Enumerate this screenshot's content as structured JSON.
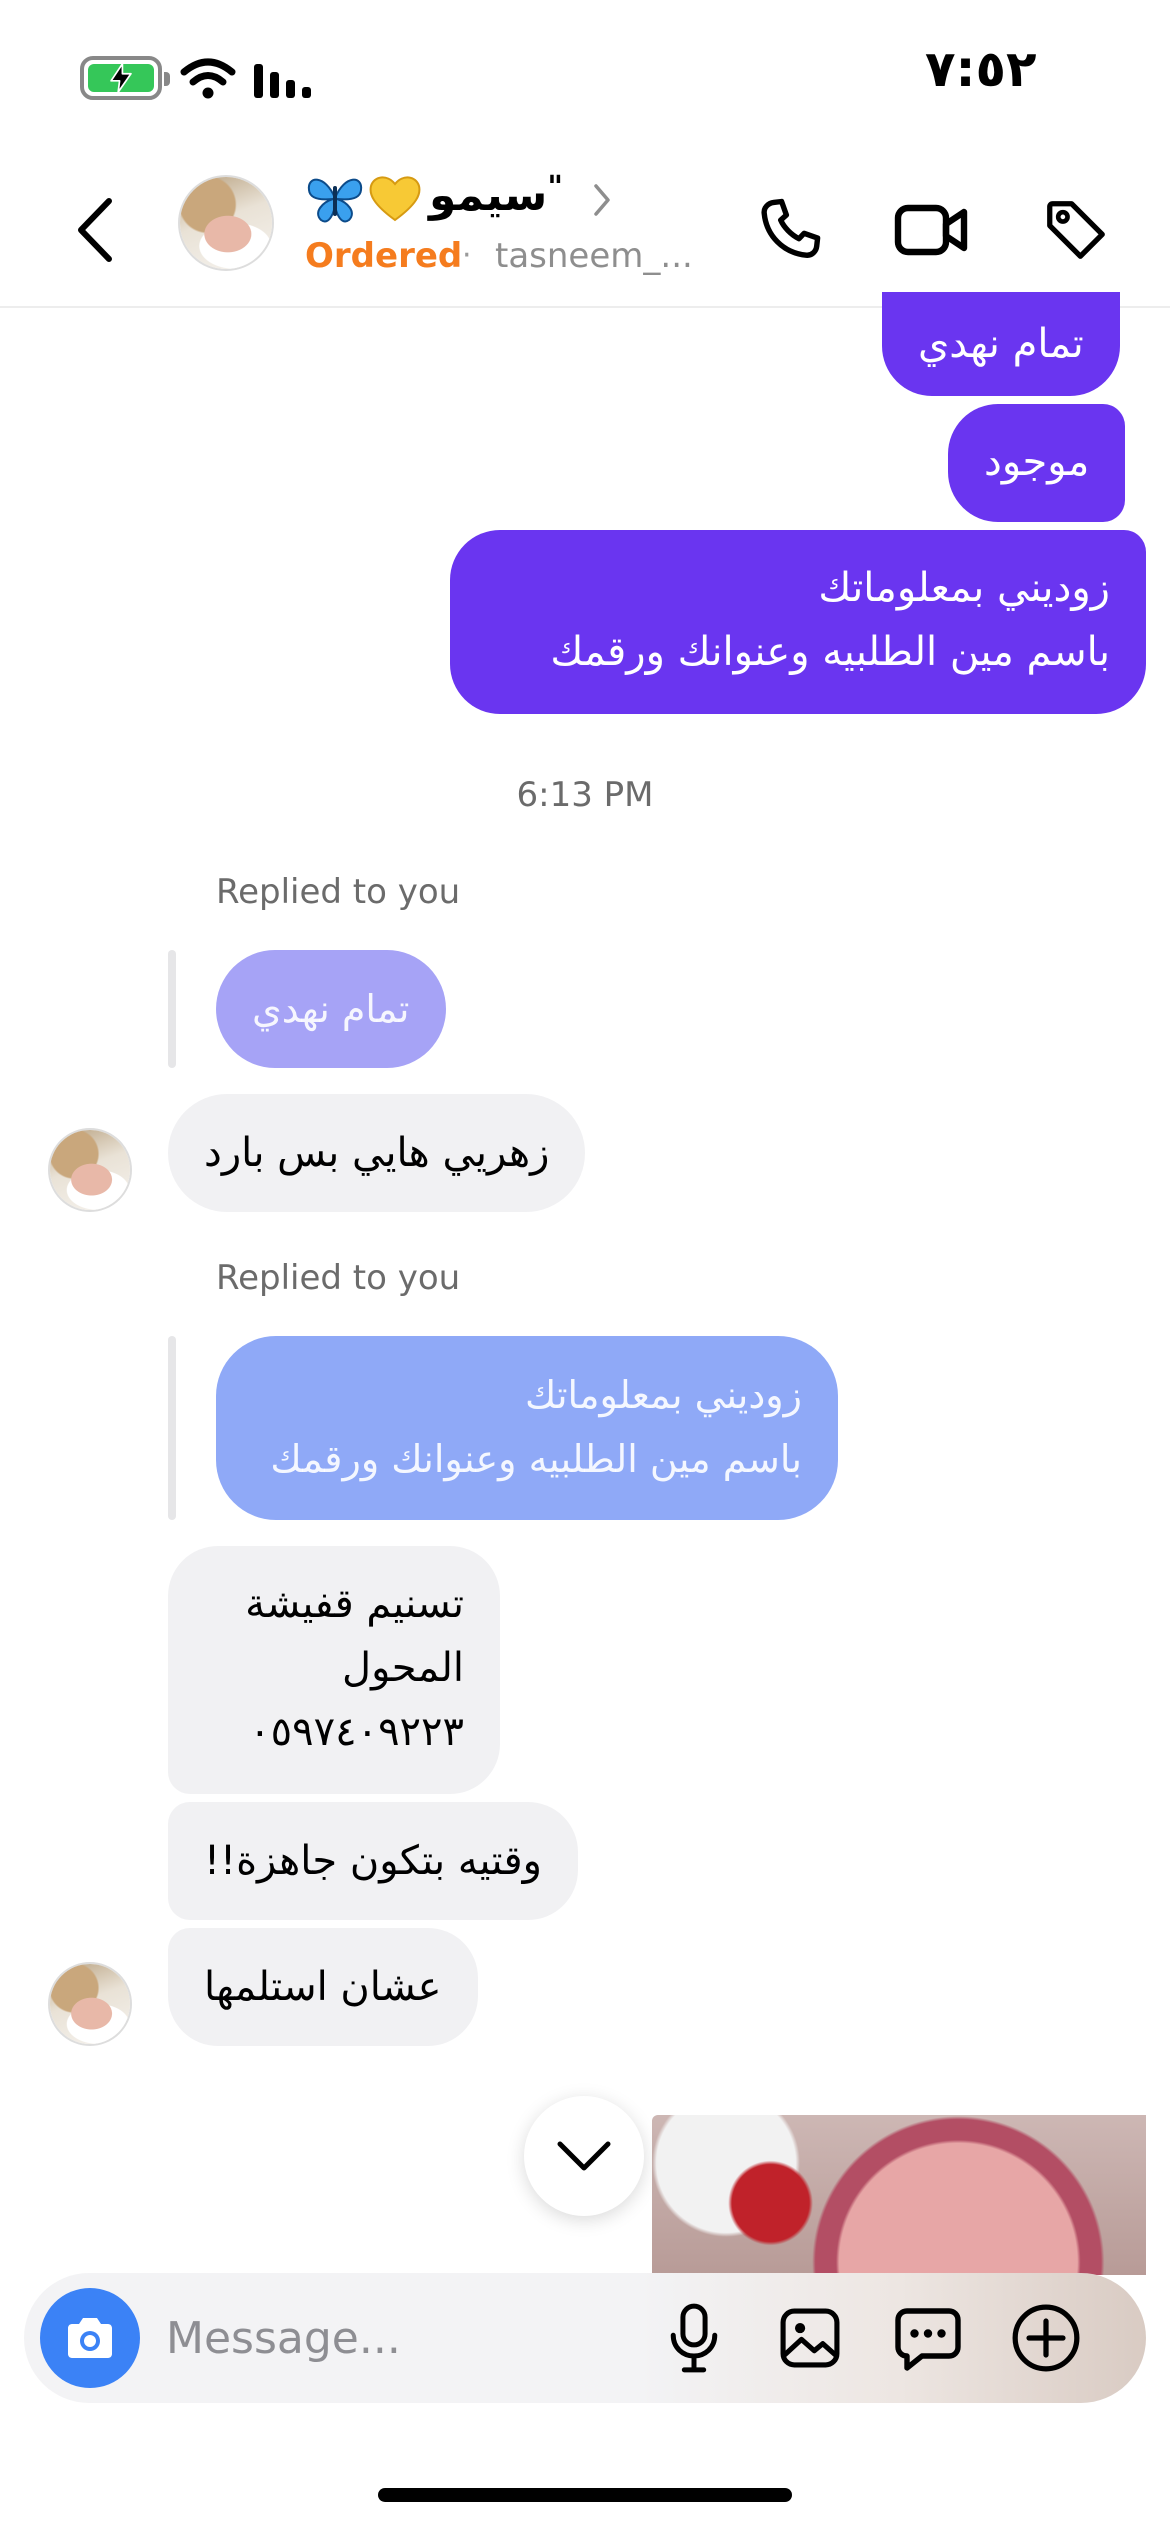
{
  "status_bar": {
    "time": "٧:٥٢"
  },
  "header": {
    "contact_name": "سيمو",
    "contact_name_mark": "\"",
    "status": "Ordered",
    "separator": "·",
    "username": "tasneem_..."
  },
  "messages": {
    "sent": [
      {
        "text": "تمام نهدي"
      },
      {
        "text": "موجود"
      },
      {
        "line1": "زوديني بمعلوماتك",
        "line2": "باسم مين الطلبيه وعنوانك ورقمك"
      }
    ],
    "timestamp": "6:13 PM",
    "reply_1": {
      "label": "Replied to you",
      "quoted": "تمام نهدي",
      "text": "زهريي  هايي بس بارد"
    },
    "reply_2": {
      "label": "Replied to you",
      "quoted_line1": "زوديني بمعلوماتك",
      "quoted_line2": "باسم مين الطلبيه وعنوانك ورقمك",
      "line1": "تسنيم قفيشة",
      "line2": "المحول",
      "line3": "٠٥٩٧٤٠٩٢٢٣"
    },
    "received": [
      {
        "text": "وقتيه بتكون جاهزة!!"
      },
      {
        "text": "عشان استلمها"
      }
    ]
  },
  "composer": {
    "placeholder": "Message..."
  },
  "colors": {
    "sent_bubble": "#6a35f0",
    "received_bubble": "#f1f1f3",
    "quote_purple": "#a6a3f6",
    "quote_blue": "#8fa9f7",
    "ordered_orange": "#f57c1e",
    "camera_blue": "#3b82f6"
  }
}
